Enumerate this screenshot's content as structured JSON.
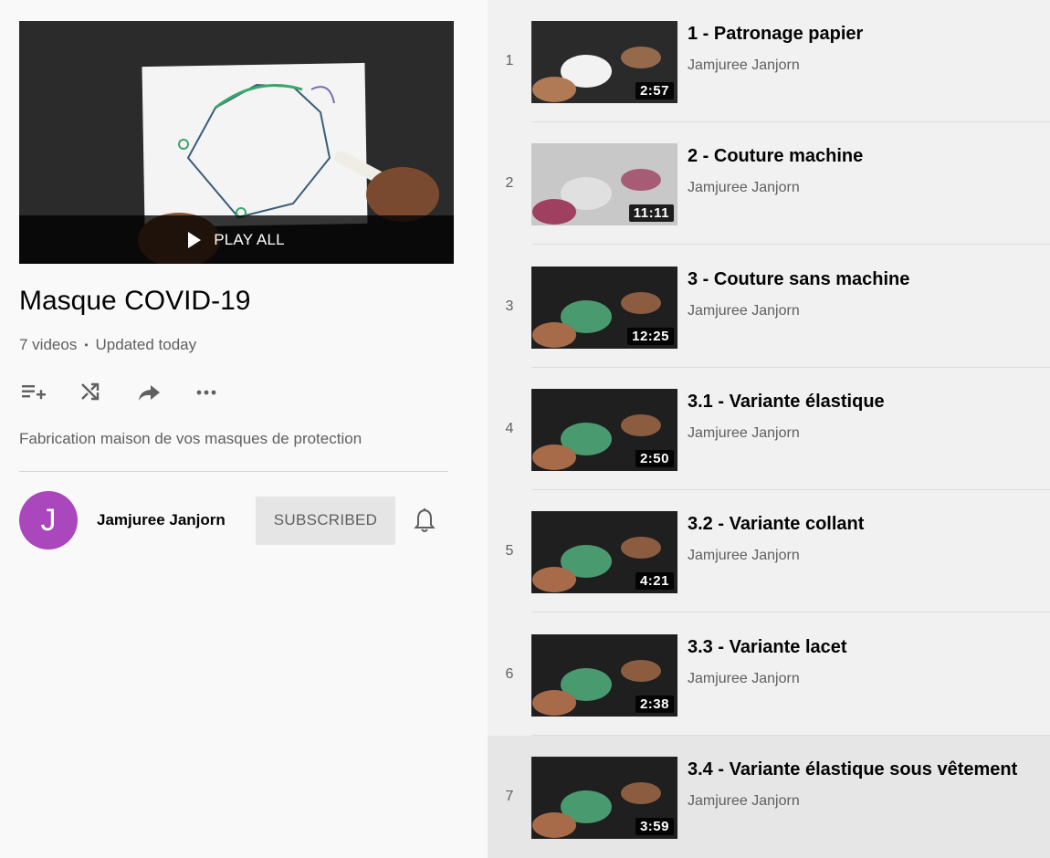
{
  "playlist": {
    "title": "Masque COVID-19",
    "video_count": "7 videos",
    "updated": "Updated today",
    "description": "Fabrication maison de vos masques de protection",
    "play_all_label": "PLAY ALL"
  },
  "actions": {
    "icons": [
      "add-to-queue-icon",
      "shuffle-icon",
      "share-icon",
      "more-icon"
    ]
  },
  "owner": {
    "avatar_letter": "J",
    "avatar_color": "#ab47bc",
    "name": "Jamjuree Janjorn",
    "subscribe_label": "SUBSCRIBED"
  },
  "videos": [
    {
      "index": "1",
      "title": "1 - Patronage papier",
      "channel": "Jamjuree Janjorn",
      "duration": "2:57"
    },
    {
      "index": "2",
      "title": "2 - Couture machine",
      "channel": "Jamjuree Janjorn",
      "duration": "11:11"
    },
    {
      "index": "3",
      "title": "3 - Couture sans machine",
      "channel": "Jamjuree Janjorn",
      "duration": "12:25"
    },
    {
      "index": "4",
      "title": "3.1 - Variante élastique",
      "channel": "Jamjuree Janjorn",
      "duration": "2:50"
    },
    {
      "index": "5",
      "title": "3.2 - Variante collant",
      "channel": "Jamjuree Janjorn",
      "duration": "4:21"
    },
    {
      "index": "6",
      "title": "3.3 - Variante lacet",
      "channel": "Jamjuree Janjorn",
      "duration": "2:38"
    },
    {
      "index": "7",
      "title": "3.4 - Variante élastique sous vêtement",
      "channel": "Jamjuree Janjorn",
      "duration": "3:59"
    }
  ],
  "active_video_index": 6
}
